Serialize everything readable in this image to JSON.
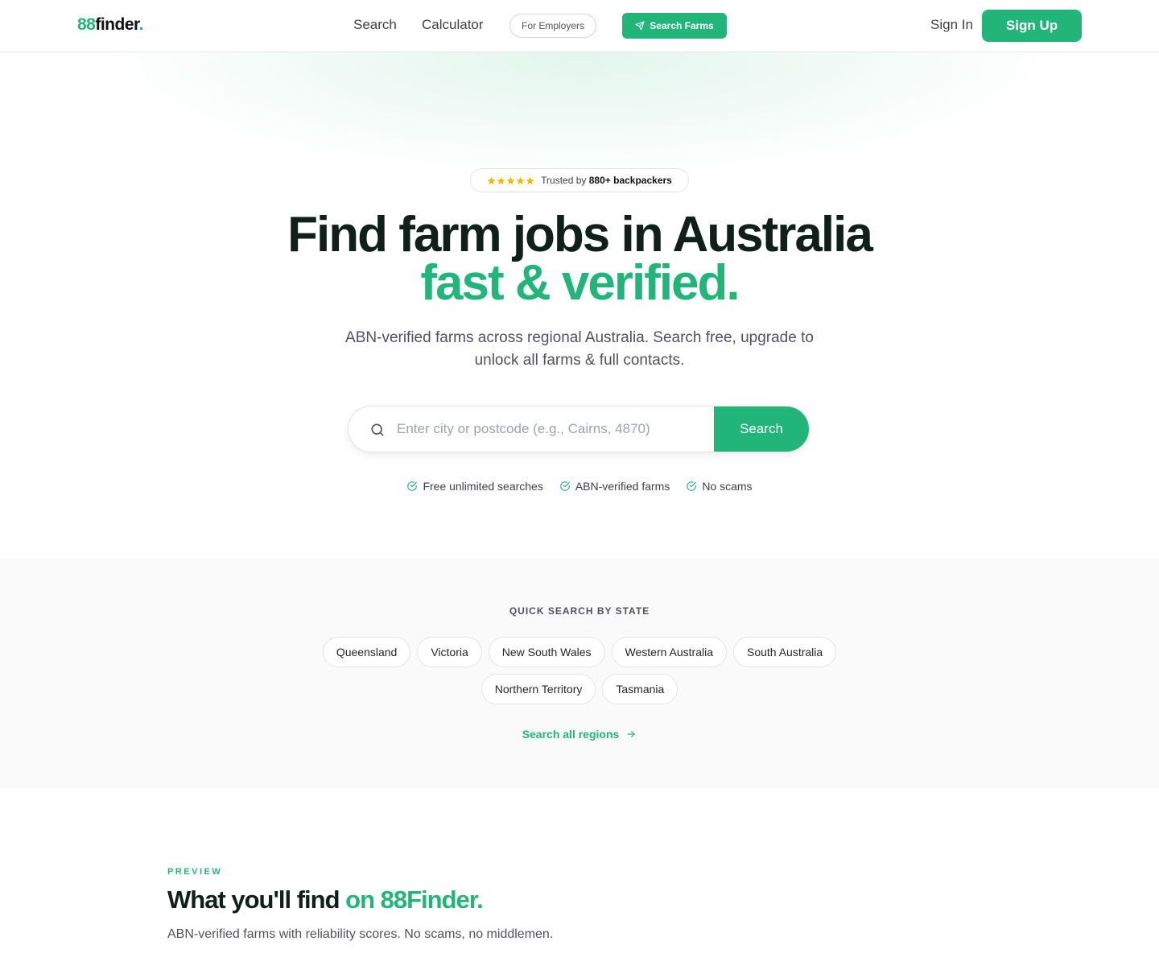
{
  "header": {
    "logo_num": "88",
    "logo_text": "finder",
    "logo_dot": ".",
    "nav": {
      "search": "Search",
      "calculator": "Calculator"
    },
    "employers": "For Employers",
    "search_farms": "Search Farms",
    "sign_in": "Sign In",
    "sign_up": "Sign Up"
  },
  "hero": {
    "trusted_prefix": "Trusted by",
    "trusted_count": "880+ backpackers",
    "headline_line1": "Find farm jobs in Australia",
    "headline_line2": "fast & verified.",
    "subtitle": "ABN-verified farms across regional Australia. Search free, upgrade to unlock all farms & full contacts.",
    "search": {
      "placeholder": "Enter city or postcode (e.g., Cairns, 4870)",
      "button": "Search"
    },
    "features": [
      "Free unlimited searches",
      "ABN-verified farms",
      "No scams"
    ]
  },
  "quick_search": {
    "title": "QUICK SEARCH BY STATE",
    "states": [
      "Queensland",
      "Victoria",
      "New South Wales",
      "Western Australia",
      "South Australia",
      "Northern Territory",
      "Tasmania"
    ],
    "all_regions": "Search all regions"
  },
  "preview": {
    "label": "PREVIEW",
    "title_main": "What you'll find",
    "title_accent": "on 88Finder.",
    "subtitle": "ABN-verified farms with reliability scores. No scams, no middlemen."
  },
  "colors": {
    "accent": "#22b57a",
    "star": "#f5b800",
    "heading": "#0f1f1a"
  },
  "icons": {
    "search": "search-icon",
    "send": "send-icon",
    "check": "check-circle-icon",
    "arrow": "arrow-right-icon",
    "star": "star-icon"
  }
}
